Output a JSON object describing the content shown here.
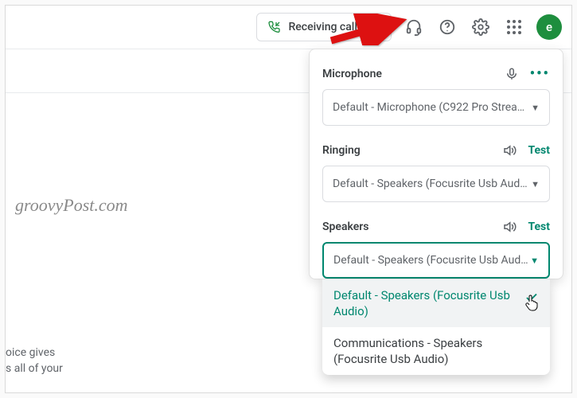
{
  "header": {
    "receiving_label": "Receiving calls",
    "avatar_letter": "e"
  },
  "watermark": "groovyPost.com",
  "snippet_line1": "oice gives",
  "snippet_line2": "s all of your",
  "panel": {
    "microphone": {
      "title": "Microphone",
      "value": "Default - Microphone (C922 Pro Strea…"
    },
    "ringing": {
      "title": "Ringing",
      "test": "Test",
      "value": "Default - Speakers (Focusrite Usb Aud…"
    },
    "speakers": {
      "title": "Speakers",
      "test": "Test",
      "value": "Default - Speakers (Focusrite Usb Aud…",
      "options": [
        "Default - Speakers (Focusrite Usb Audio)",
        "Communications - Speakers (Focusrite Usb Audio)"
      ],
      "selected_index": 0
    }
  }
}
